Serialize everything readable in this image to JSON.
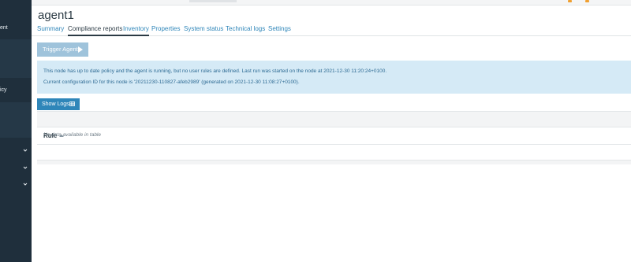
{
  "sidebar": {
    "items": [
      {
        "label": "ent"
      },
      {
        "label": "icy"
      }
    ]
  },
  "page": {
    "title": "agent1"
  },
  "tabs": [
    {
      "label": "Summary"
    },
    {
      "label": "Compliance reports"
    },
    {
      "label": "Inventory"
    },
    {
      "label": "Properties"
    },
    {
      "label": "System status"
    },
    {
      "label": "Technical logs"
    },
    {
      "label": "Settings"
    }
  ],
  "actions": {
    "trigger_label": "Trigger Agent",
    "show_logs_label": "Show Logs"
  },
  "info": {
    "line1": "This node has up to date policy and the agent is running, but no user rules are defined. Last run was started on the node at 2021-12-30 11:20:24+0100.",
    "line2": "Current configuration ID for this node is '20211230-110827-afeb2989' (generated on 2021-12-30 11:08:27+0100)."
  },
  "table": {
    "column_rule": "Rule",
    "empty_text": "No data available in table"
  },
  "colors": {
    "accent": "#2f86b9",
    "sidebar_bg": "#1f2f3c",
    "info_bg": "#d5eaf6"
  }
}
